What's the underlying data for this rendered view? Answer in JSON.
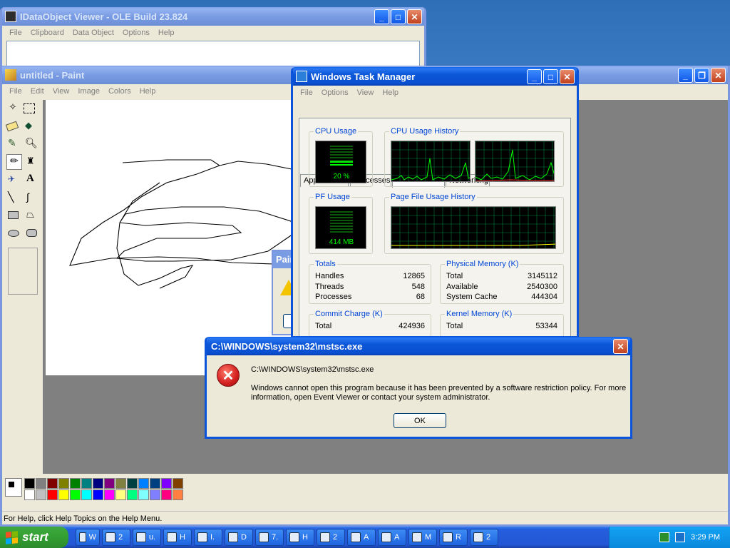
{
  "idata_viewer": {
    "title": "IDataObject Viewer - OLE Build 23.824",
    "menu": [
      "File",
      "Clipboard",
      "Data Object",
      "Options",
      "Help"
    ]
  },
  "paint": {
    "title": "untitled - Paint",
    "menu": [
      "File",
      "Edit",
      "View",
      "Image",
      "Colors",
      "Help"
    ],
    "status": "For Help, click Help Topics on the Help Menu.",
    "palette_top": [
      "#000000",
      "#808080",
      "#800000",
      "#808000",
      "#008000",
      "#008080",
      "#000080",
      "#800080",
      "#808040",
      "#004040",
      "#0080ff",
      "#004080",
      "#8000ff",
      "#804000"
    ],
    "palette_bottom": [
      "#ffffff",
      "#c0c0c0",
      "#ff0000",
      "#ffff00",
      "#00ff00",
      "#00ffff",
      "#0000ff",
      "#ff00ff",
      "#ffff80",
      "#00ff80",
      "#80ffff",
      "#8080ff",
      "#ff0080",
      "#ff8040"
    ],
    "hidden_dialog_title": "Pair"
  },
  "taskmgr": {
    "title": "Windows Task Manager",
    "menu": [
      "File",
      "Options",
      "View",
      "Help"
    ],
    "tabs": [
      "Applications",
      "Processes",
      "Performance",
      "Networking"
    ],
    "cpu_usage_label": "CPU Usage",
    "cpu_usage_value": "20 %",
    "cpu_history_label": "CPU Usage History",
    "pf_usage_label": "PF Usage",
    "pf_usage_value": "414 MB",
    "pf_history_label": "Page File Usage History",
    "totals": {
      "label": "Totals",
      "rows": [
        {
          "name": "Handles",
          "value": "12865"
        },
        {
          "name": "Threads",
          "value": "548"
        },
        {
          "name": "Processes",
          "value": "68"
        }
      ]
    },
    "physical": {
      "label": "Physical Memory (K)",
      "rows": [
        {
          "name": "Total",
          "value": "3145112"
        },
        {
          "name": "Available",
          "value": "2540300"
        },
        {
          "name": "System Cache",
          "value": "444304"
        }
      ]
    },
    "commit": {
      "label": "Commit Charge (K)",
      "rows": [
        {
          "name": "Total",
          "value": "424936"
        }
      ]
    },
    "kernel": {
      "label": "Kernel Memory (K)",
      "rows": [
        {
          "name": "Total",
          "value": "53344"
        }
      ]
    }
  },
  "error_dialog": {
    "title": "C:\\WINDOWS\\system32\\mstsc.exe",
    "path": "C:\\WINDOWS\\system32\\mstsc.exe",
    "message": "Windows cannot open this program because it has been prevented by a software restriction policy. For more information, open Event Viewer or contact your system administrator.",
    "ok_label": "OK"
  },
  "taskbar": {
    "start_label": "start",
    "buttons": [
      "W",
      "2",
      "u.",
      "H",
      "I.",
      "D",
      "7.",
      "H",
      "2",
      "A",
      "A",
      "M",
      "R",
      "2"
    ],
    "clock": "3:29 PM"
  },
  "colors": {
    "xp_blue": "#0a54dc",
    "graph_green": "#00ff00",
    "graph_grid": "#008040",
    "error_red": "#d21f1f"
  }
}
